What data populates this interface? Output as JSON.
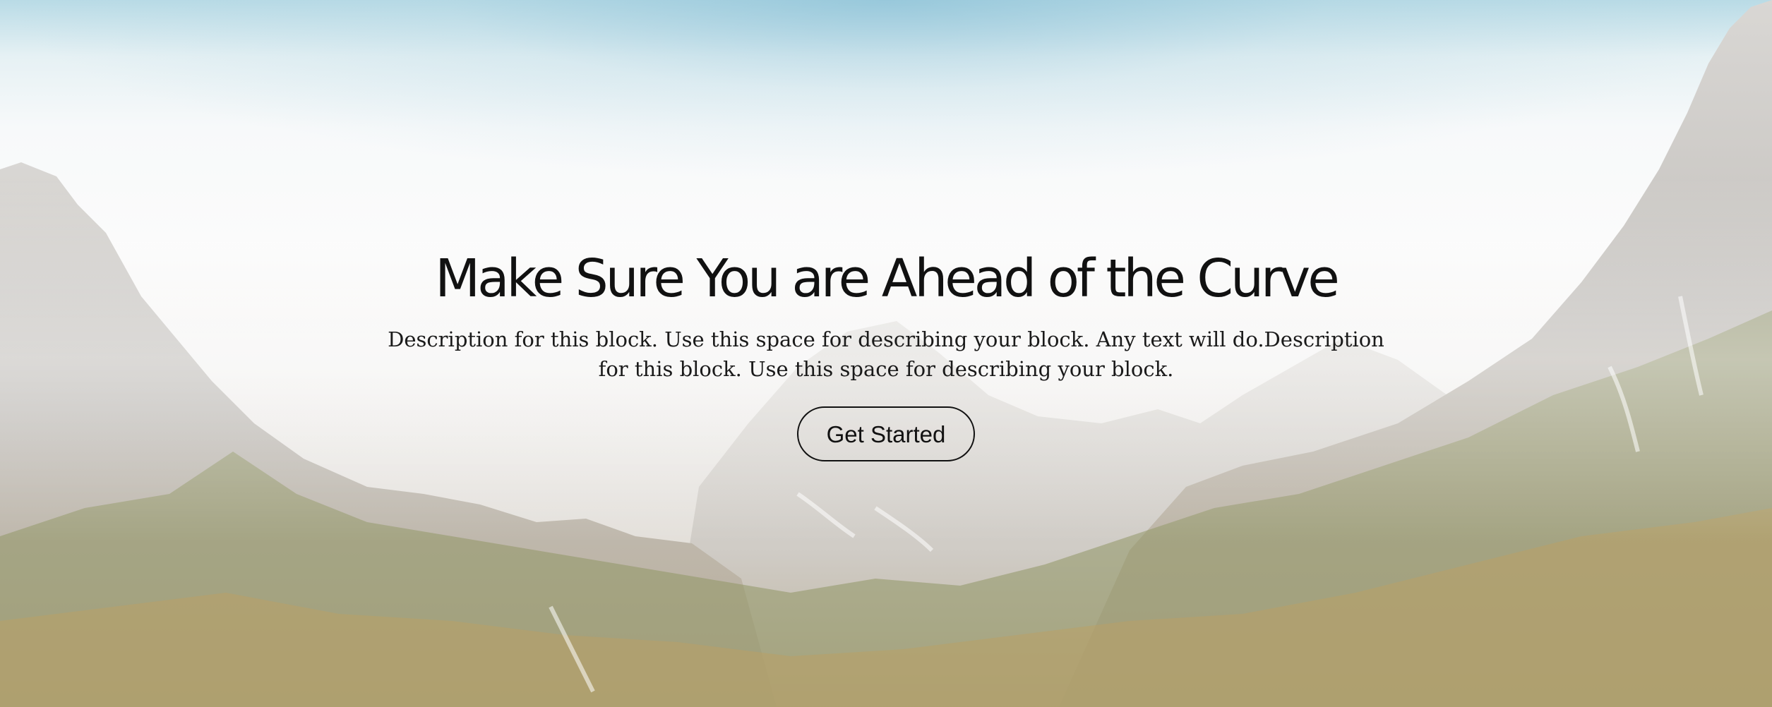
{
  "hero": {
    "headline": "Make Sure You are Ahead of the Curve",
    "description": "Description for this block. Use this space for describing your block. Any text will do.Description for this block. Use this space for describing your block.",
    "cta_label": "Get Started"
  },
  "background": {
    "image_subject": "mountain-landscape",
    "colors": {
      "sky": "#b9dbe6",
      "haze": "#fbfbfb",
      "rock": "#c9c6c2",
      "vegetation": "#7b8a57",
      "autumn": "#c9a55a"
    }
  }
}
